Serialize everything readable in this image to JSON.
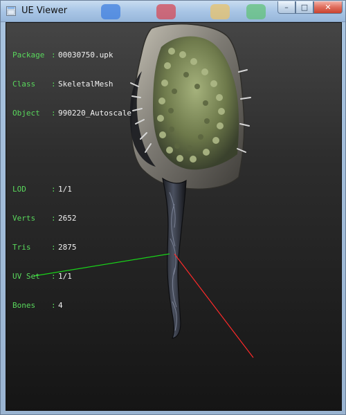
{
  "window": {
    "title": "UE Viewer"
  },
  "overlay": {
    "package_label": "Package",
    "package_value": "00030750.upk",
    "class_label": "Class",
    "class_value": "SkeletalMesh",
    "object_label": "Object",
    "object_value": "990220_Autoscale",
    "lod_label": "LOD",
    "lod_value": "1/1",
    "verts_label": "Verts",
    "verts_value": "2652",
    "tris_label": "Tris",
    "tris_value": "2875",
    "uvset_label": "UV Set",
    "uvset_value": "1/1",
    "bones_label": "Bones",
    "bones_value": "4"
  },
  "viewport": {
    "model": "textured-club-or-mace",
    "axis_colors": {
      "x": "#ff2a2a",
      "y": "#19d419"
    }
  }
}
